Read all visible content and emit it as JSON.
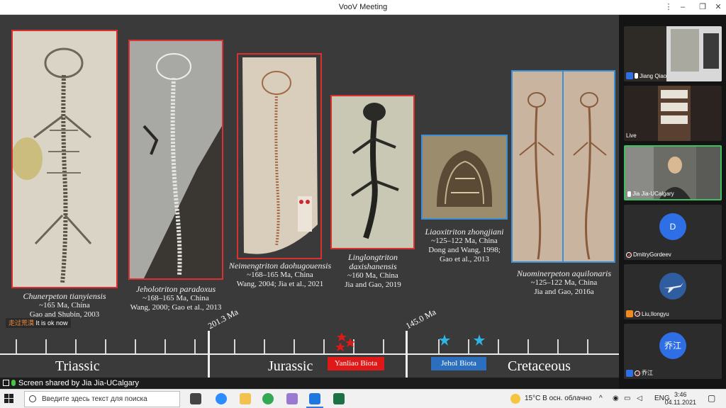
{
  "window": {
    "title": "VooV Meeting"
  },
  "slide": {
    "fossils": [
      {
        "species": "Chunerpeton tianyiensis",
        "line1": "~165 Ma, China",
        "line2": "Gao and Shubin, 2003"
      },
      {
        "species": "Jeholotriton paradoxus",
        "line1": "~168–165 Ma, China",
        "line2": "Wang, 2000; Gao et al., 2013"
      },
      {
        "species": "Neimengtriton daohugouensis",
        "line1": "~168–165 Ma, China",
        "line2": "Wang, 2004; Jia et al., 2021"
      },
      {
        "species": "Linglongtriton daxishanensis",
        "line1": "~160 Ma, China",
        "line2": "Jia and Gao, 2019"
      },
      {
        "species": "Liaoxitriton zhongjiani",
        "line1": "~125–122 Ma, China",
        "line2": "Dong and Wang, 1998;",
        "line3": "Gao et al., 2013"
      },
      {
        "species": "Nuominerpeton aquilonaris",
        "line1": "~125–122 Ma, China",
        "line2": "Jia and Gao, 2016a"
      }
    ],
    "subtitle": {
      "name": "走过荒漠",
      "text": "It is ok now"
    },
    "timeline": {
      "periods": [
        "Triassic",
        "Jurassic",
        "Cretaceous"
      ],
      "boundaries": [
        "201.3 Ma",
        "145.0 Ma"
      ],
      "biotas": [
        "Yanliao Biota",
        "Jehol Biota"
      ]
    }
  },
  "share_status": "Screen shared by Jia Jia-UCalgary",
  "participants": [
    {
      "name": "Jiang Qiao"
    },
    {
      "name": "Live"
    },
    {
      "name": "Jia Jia-UCalgary"
    },
    {
      "name": "DmitryGordeev",
      "initial": "D"
    },
    {
      "name": "Liu,Ilongyu"
    },
    {
      "name": "乔江",
      "initial": "乔江"
    }
  ],
  "taskbar": {
    "search_placeholder": "Введите здесь текст для поиска",
    "weather": "15°C  В осн. облачно",
    "lang": "ENG",
    "time": "3:46",
    "date": "04.11.2021"
  },
  "colors": {
    "red_frame": "#d93030",
    "blue_frame": "#3a8fd6",
    "yanliao": "#e01818",
    "jehol": "#2d6fbf"
  }
}
